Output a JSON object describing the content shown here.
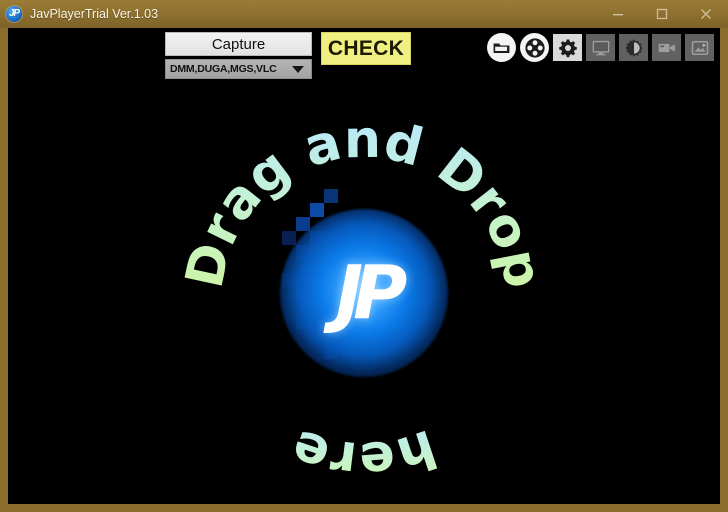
{
  "window": {
    "title": "JavPlayerTrial Ver.1.03",
    "app_icon": "jp-app-icon",
    "icon_label": "JP",
    "titlebar_color": "#8c6f2f",
    "controls": [
      {
        "name": "minimize",
        "glyph": "minimize-icon"
      },
      {
        "name": "maximize",
        "glyph": "maximize-icon"
      },
      {
        "name": "close",
        "glyph": "close-icon"
      }
    ]
  },
  "toolbar": {
    "capture_label": "Capture",
    "source_value": "DMM,DUGA,MGS,VLC",
    "source_options": [
      "DMM,DUGA,MGS,VLC"
    ],
    "check_label": "CHECK",
    "check_color": "#f0ef82",
    "icons": [
      {
        "name": "open-folder-icon",
        "style": "round"
      },
      {
        "name": "disc-icon",
        "style": "round"
      },
      {
        "name": "gear-icon",
        "style": "square-light"
      },
      {
        "name": "monitor-icon",
        "style": "square"
      },
      {
        "name": "brightness-icon",
        "style": "square"
      },
      {
        "name": "camcorder-icon",
        "style": "square"
      },
      {
        "name": "image-add-icon",
        "style": "square"
      }
    ]
  },
  "dropzone": {
    "circular_text": "Drag and Drop here",
    "text_top": "Drag and Drop",
    "text_bottom": "here",
    "text_color_start": "#bfeaff",
    "text_color_end": "#c9f5a8",
    "logo_text": "JP",
    "glow_color": "#0b7ae8",
    "background": "#000000"
  }
}
